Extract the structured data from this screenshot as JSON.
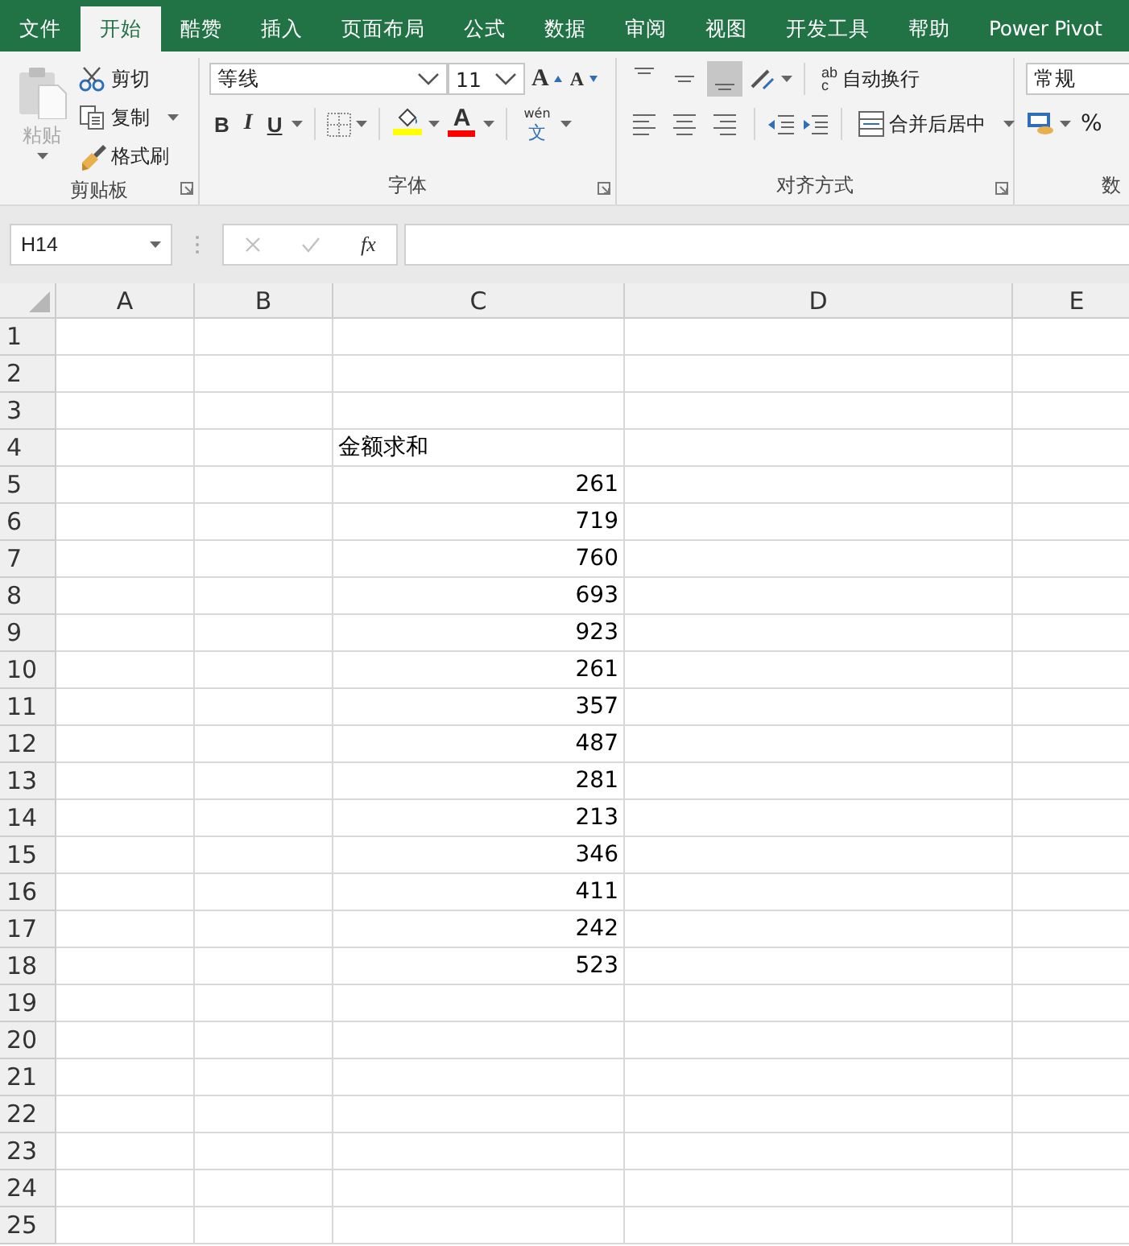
{
  "tabs": [
    {
      "label": "文件",
      "selected": false
    },
    {
      "label": "开始",
      "selected": true
    },
    {
      "label": "酷赞",
      "selected": false
    },
    {
      "label": "插入",
      "selected": false
    },
    {
      "label": "页面布局",
      "selected": false
    },
    {
      "label": "公式",
      "selected": false
    },
    {
      "label": "数据",
      "selected": false
    },
    {
      "label": "审阅",
      "selected": false
    },
    {
      "label": "视图",
      "selected": false
    },
    {
      "label": "开发工具",
      "selected": false
    },
    {
      "label": "帮助",
      "selected": false
    },
    {
      "label": "Power Pivot",
      "selected": false
    }
  ],
  "clipboard": {
    "title": "剪贴板",
    "paste": {
      "label": "粘贴",
      "disabled": true
    },
    "cut": "剪切",
    "copy": "复制",
    "format_painter": "格式刷"
  },
  "font": {
    "title": "字体",
    "font_name": "等线",
    "font_size": "11",
    "grow": "A",
    "shrink": "A",
    "bold": "B",
    "italic": "I",
    "underline": "U",
    "fill": {
      "color": "#ffff00"
    },
    "font_color": {
      "glyph": "A",
      "color": "#ff0000"
    },
    "phonetic": {
      "top": "wén",
      "bottom": "文"
    }
  },
  "alignment": {
    "title": "对齐方式",
    "wrap": {
      "label": "自动换行",
      "glyph_top": "ab",
      "glyph_bottom": "c"
    },
    "merge": "合并后居中",
    "buttons": [
      {
        "kind": "top",
        "selected": false
      },
      {
        "kind": "middle",
        "selected": false
      },
      {
        "kind": "bottom",
        "selected": true
      },
      {
        "kind": "left",
        "selected": false
      },
      {
        "kind": "center",
        "selected": false
      },
      {
        "kind": "right",
        "selected": false
      }
    ]
  },
  "number": {
    "title": "数",
    "format": "常规",
    "percent": "%"
  },
  "formula_bar": {
    "name_box": "H14",
    "function_label": "fx"
  },
  "sheet": {
    "columns": [
      "A",
      "B",
      "C",
      "D",
      "E"
    ],
    "rows": [
      {
        "header": "1"
      },
      {
        "header": "2"
      },
      {
        "header": "3"
      },
      {
        "header": "4",
        "C": {
          "kind": "text",
          "text": "金额求和"
        }
      },
      {
        "header": "5",
        "C": {
          "kind": "number",
          "text": "261"
        }
      },
      {
        "header": "6",
        "C": {
          "kind": "number",
          "text": "719"
        }
      },
      {
        "header": "7",
        "C": {
          "kind": "number",
          "text": "760"
        }
      },
      {
        "header": "8",
        "C": {
          "kind": "number",
          "text": "693"
        }
      },
      {
        "header": "9",
        "C": {
          "kind": "number",
          "text": "923"
        }
      },
      {
        "header": "10",
        "C": {
          "kind": "number",
          "text": "261"
        }
      },
      {
        "header": "11",
        "C": {
          "kind": "number",
          "text": "357"
        }
      },
      {
        "header": "12",
        "C": {
          "kind": "number",
          "text": "487"
        }
      },
      {
        "header": "13",
        "C": {
          "kind": "number",
          "text": "281"
        }
      },
      {
        "header": "14",
        "C": {
          "kind": "number",
          "text": "213"
        }
      },
      {
        "header": "15",
        "C": {
          "kind": "number",
          "text": "346"
        }
      },
      {
        "header": "16",
        "C": {
          "kind": "number",
          "text": "411"
        }
      },
      {
        "header": "17",
        "C": {
          "kind": "number",
          "text": "242"
        }
      },
      {
        "header": "18",
        "C": {
          "kind": "number",
          "text": "523"
        }
      },
      {
        "header": "19"
      },
      {
        "header": "20"
      },
      {
        "header": "21"
      },
      {
        "header": "22"
      },
      {
        "header": "23"
      },
      {
        "header": "24"
      },
      {
        "header": "25"
      }
    ]
  }
}
